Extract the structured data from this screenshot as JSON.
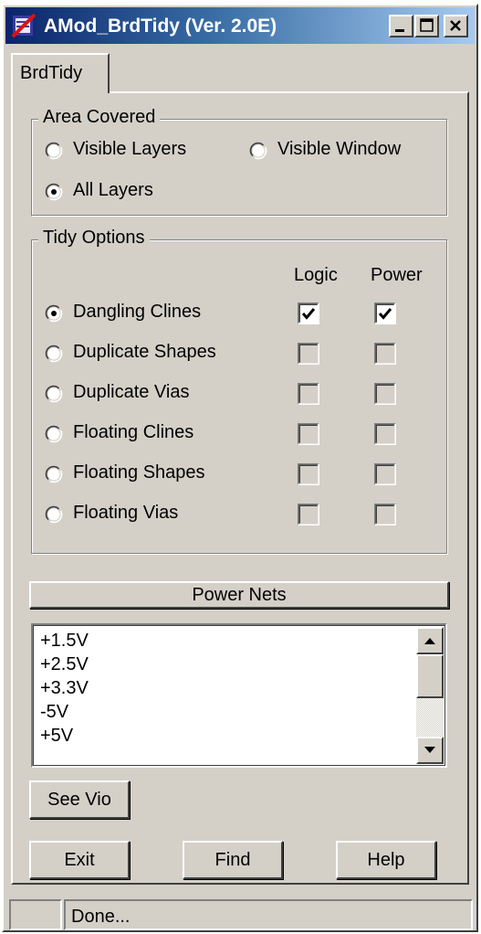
{
  "window": {
    "title": "AMod_BrdTidy (Ver. 2.0E)",
    "controls": [
      "minimize-button",
      "maximize-button",
      "close-button"
    ]
  },
  "tab": {
    "label": "BrdTidy"
  },
  "area_covered": {
    "legend": "Area Covered",
    "options": [
      {
        "label": "Visible Layers",
        "selected": false
      },
      {
        "label": "Visible Window",
        "selected": false
      },
      {
        "label": "All Layers",
        "selected": true
      }
    ]
  },
  "tidy_options": {
    "legend": "Tidy Options",
    "col_logic": "Logic",
    "col_power": "Power",
    "rows": [
      {
        "label": "Dangling Clines",
        "selected": true,
        "logic": true,
        "power": true,
        "enabled": true
      },
      {
        "label": "Duplicate Shapes",
        "selected": false,
        "logic": false,
        "power": false,
        "enabled": false
      },
      {
        "label": "Duplicate Vias",
        "selected": false,
        "logic": false,
        "power": false,
        "enabled": false
      },
      {
        "label": "Floating Clines",
        "selected": false,
        "logic": false,
        "power": false,
        "enabled": false
      },
      {
        "label": "Floating Shapes",
        "selected": false,
        "logic": false,
        "power": false,
        "enabled": false
      },
      {
        "label": "Floating Vias",
        "selected": false,
        "logic": false,
        "power": false,
        "enabled": false
      }
    ]
  },
  "power_nets": {
    "button_label": "Power Nets",
    "items": [
      "+1.5V",
      "+2.5V",
      "+3.3V",
      "-5V",
      "+5V"
    ]
  },
  "buttons": {
    "see_vio": "See Vio",
    "exit": "Exit",
    "find": "Find",
    "help": "Help"
  },
  "status": {
    "text": "Done..."
  },
  "colors": {
    "face": "#d4d0c8",
    "title_start": "#0a246a",
    "title_end": "#a6caf0"
  }
}
